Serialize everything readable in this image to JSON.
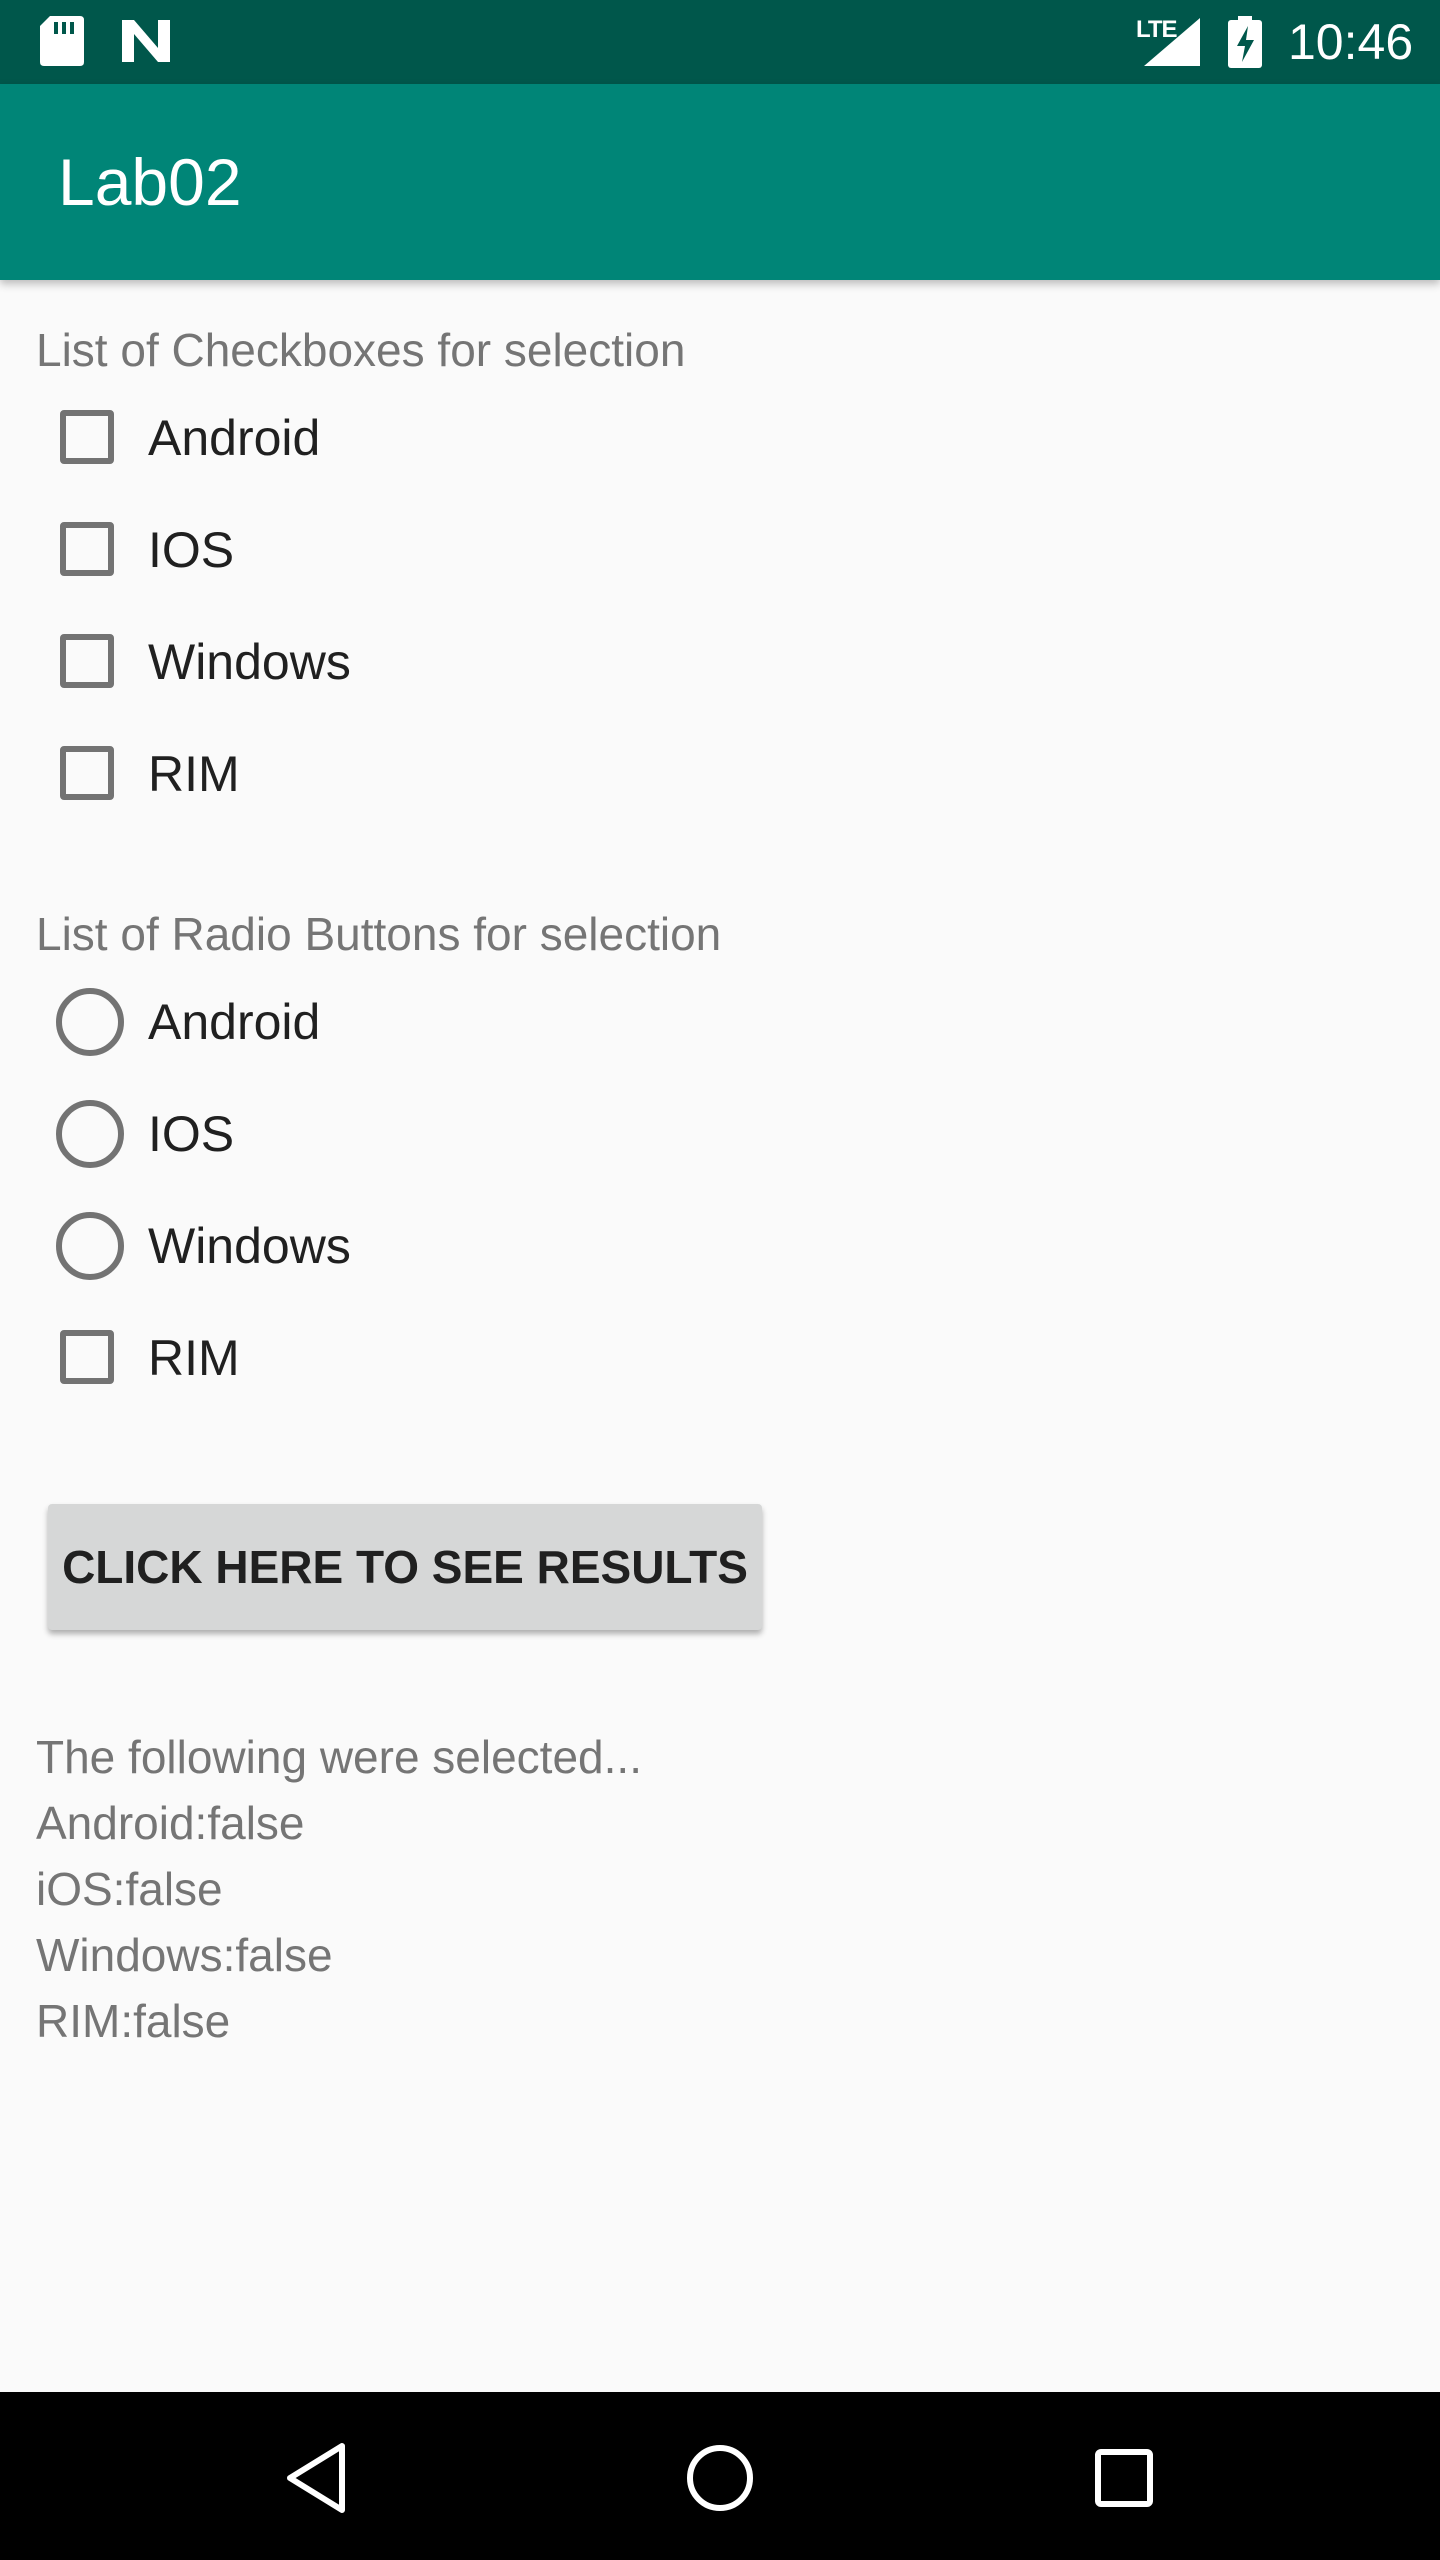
{
  "status_bar": {
    "network_label": "LTE",
    "time": "10:46",
    "icons": [
      "sd-card-icon",
      "n-notification-icon",
      "cell-signal-icon",
      "battery-charging-icon"
    ]
  },
  "app_bar": {
    "title": "Lab02"
  },
  "checkbox_section": {
    "label": "List of Checkboxes for selection",
    "options": [
      "Android",
      "IOS",
      "Windows",
      "RIM"
    ]
  },
  "radio_section": {
    "label": "List of Radio Buttons for selection",
    "options": [
      "Android",
      "IOS",
      "Windows",
      "RIM"
    ]
  },
  "results_button": {
    "label": "CLICK HERE TO SEE RESULTS"
  },
  "results": {
    "lines": [
      "The following were selected...",
      "Android:false",
      "iOS:false",
      "Windows:false",
      "RIM:false"
    ]
  },
  "nav_bar": {
    "icons": [
      "back-icon",
      "home-icon",
      "recents-icon"
    ]
  },
  "colors": {
    "status_bar": "#00574B",
    "app_bar": "#008577",
    "background": "#FAFAFA",
    "button": "#D6D7D7",
    "nav_bar": "#000000"
  }
}
